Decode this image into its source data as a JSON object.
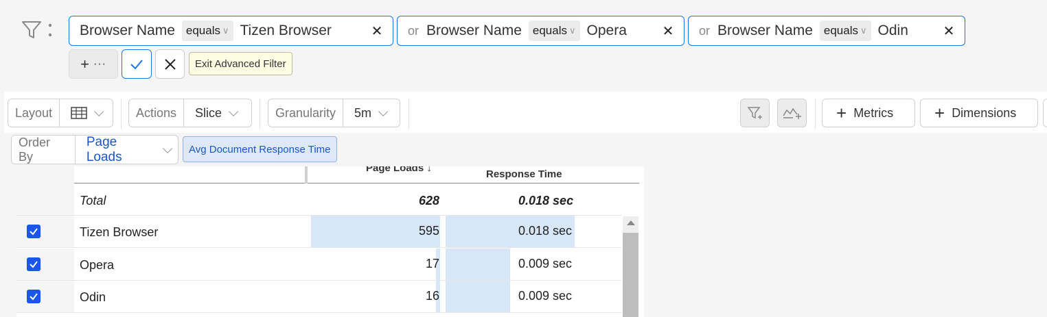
{
  "filters": [
    {
      "prefix": "",
      "field": "Browser Name",
      "operator": "equals",
      "value": "Tizen Browser"
    },
    {
      "prefix": "or",
      "field": "Browser Name",
      "operator": "equals",
      "value": "Opera"
    },
    {
      "prefix": "or",
      "field": "Browser Name",
      "operator": "equals",
      "value": "Odin"
    }
  ],
  "filter_actions": {
    "add_symbol": "+",
    "more_symbol": "···",
    "tooltip": "Exit Advanced Filter"
  },
  "toolbar": {
    "layout_label": "Layout",
    "actions_label": "Actions",
    "actions_value": "Slice",
    "granularity_label": "Granularity",
    "granularity_value": "5m",
    "metrics_label": "Metrics",
    "dimensions_label": "Dimensions"
  },
  "order": {
    "label": "Order By",
    "value": "Page Loads",
    "secondary": "Avg Document Response Time"
  },
  "table": {
    "headers": {
      "col1": "Page Loads ↓",
      "col2": "Response Time"
    },
    "total": {
      "label": "Total",
      "page_loads": "628",
      "response": "0.018 sec"
    },
    "rows": [
      {
        "name": "Tizen Browser",
        "page_loads": "595",
        "response": "0.018 sec",
        "page_loads_value": 595,
        "response_value": 0.018
      },
      {
        "name": "Opera",
        "page_loads": "17",
        "response": "0.009 sec",
        "page_loads_value": 17,
        "response_value": 0.009
      },
      {
        "name": "Odin",
        "page_loads": "16",
        "response": "0.009 sec",
        "page_loads_value": 16,
        "response_value": 0.009
      }
    ]
  },
  "colors": {
    "accent": "#1a73e8",
    "bar": "#d7e7f8",
    "checkbox": "#1a56e8"
  }
}
